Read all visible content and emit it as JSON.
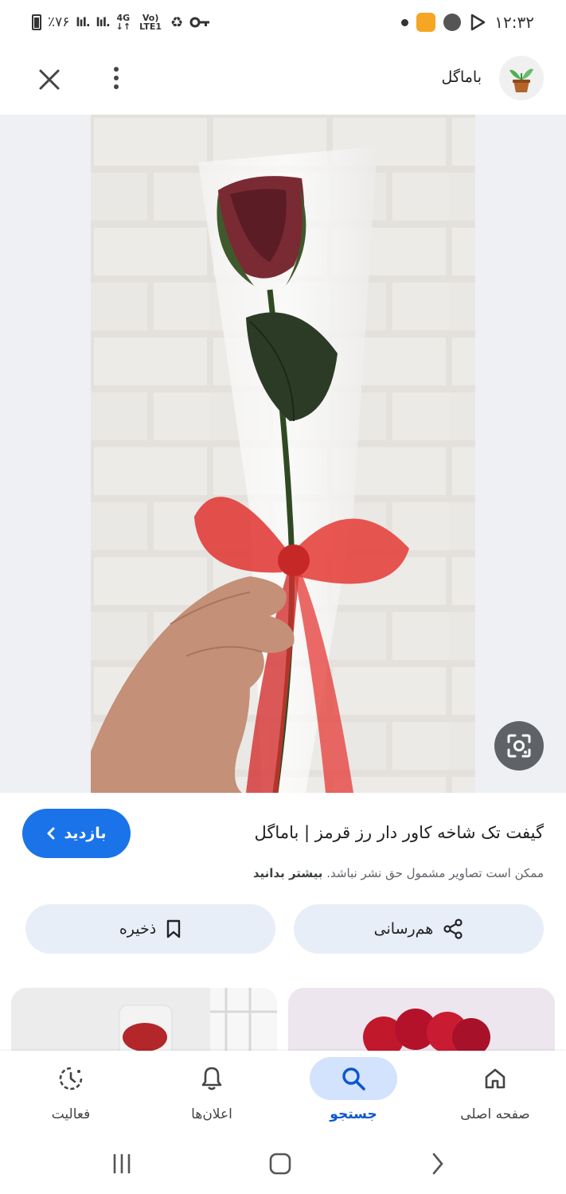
{
  "status_bar": {
    "battery": "٪۷۶",
    "signal1": "lıl.",
    "signal2": "lıl.",
    "network_top": "4G",
    "network_bottom": "Vo) LTE1",
    "time": "۱۲:۳۲"
  },
  "header": {
    "site_name": "باماگل",
    "icons": {
      "close": "close-icon",
      "more": "more-vert-icon",
      "logo": "potted-plant-icon"
    }
  },
  "image": {
    "description_icon": "lens-icon"
  },
  "result": {
    "visit_label": "بازدید",
    "title": "گیفت تک شاخه کاور دار رز قرمز | باماگل",
    "copyright_text": "ممکن است تصاویر مشمول حق نشر نباشد.",
    "learn_more": "بیشتر بدانید",
    "share_label": "هم‌رسانی",
    "save_label": "ذخیره"
  },
  "bottom_nav": {
    "items": [
      {
        "label": "صفحه اصلی",
        "icon": "home-icon"
      },
      {
        "label": "جستجو",
        "icon": "search-icon"
      },
      {
        "label": "اعلان‌ها",
        "icon": "bell-icon"
      },
      {
        "label": "فعالیت",
        "icon": "activity-icon"
      }
    ],
    "active_index": 1
  },
  "colors": {
    "accent": "#1a73e8",
    "chip_bg": "#e8eef7",
    "active_nav_bg": "#d3e3fd"
  }
}
